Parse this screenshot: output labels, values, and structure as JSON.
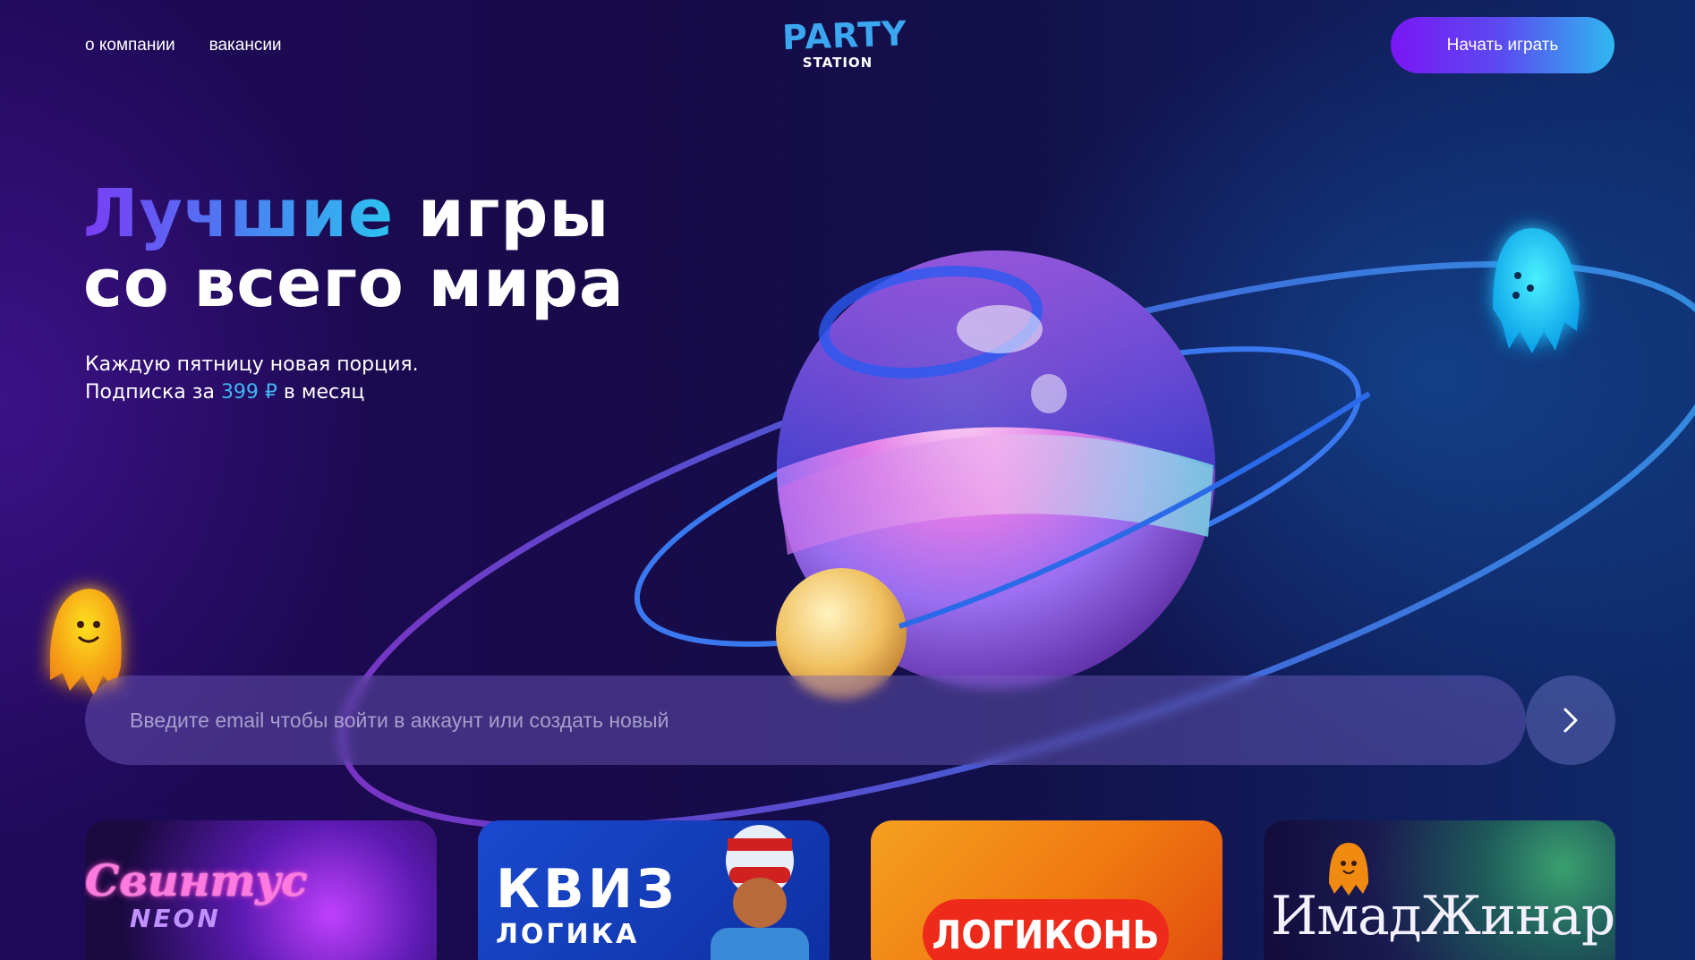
{
  "nav": {
    "about": "о компании",
    "jobs": "вакансии"
  },
  "logo": {
    "party": "PARTY",
    "station": "STATION"
  },
  "header": {
    "cta_label": "Начать играть"
  },
  "hero": {
    "title_accent": "Лучшие",
    "title_rest_line1": "игры",
    "title_line2": "со всего мира",
    "sub_line1": "Каждую пятницу новая порция.",
    "sub_line2_prefix": "Подписка за",
    "price": "399 ₽",
    "sub_line2_suffix": "в месяц"
  },
  "email": {
    "placeholder": "Введите email чтобы войти в аккаунт или создать новый"
  },
  "cards": [
    {
      "title": "Свинтус",
      "subtitle": "NEON"
    },
    {
      "title": "КВИЗ",
      "subtitle": "ЛОГИКА"
    },
    {
      "title": "ЛОГИКОНЬ"
    },
    {
      "title": "ИмадЖинариуМ"
    }
  ],
  "colors": {
    "accent_blue": "#3fb6f3",
    "cta_start": "#7a16f5",
    "cta_end": "#2fb8f0"
  }
}
